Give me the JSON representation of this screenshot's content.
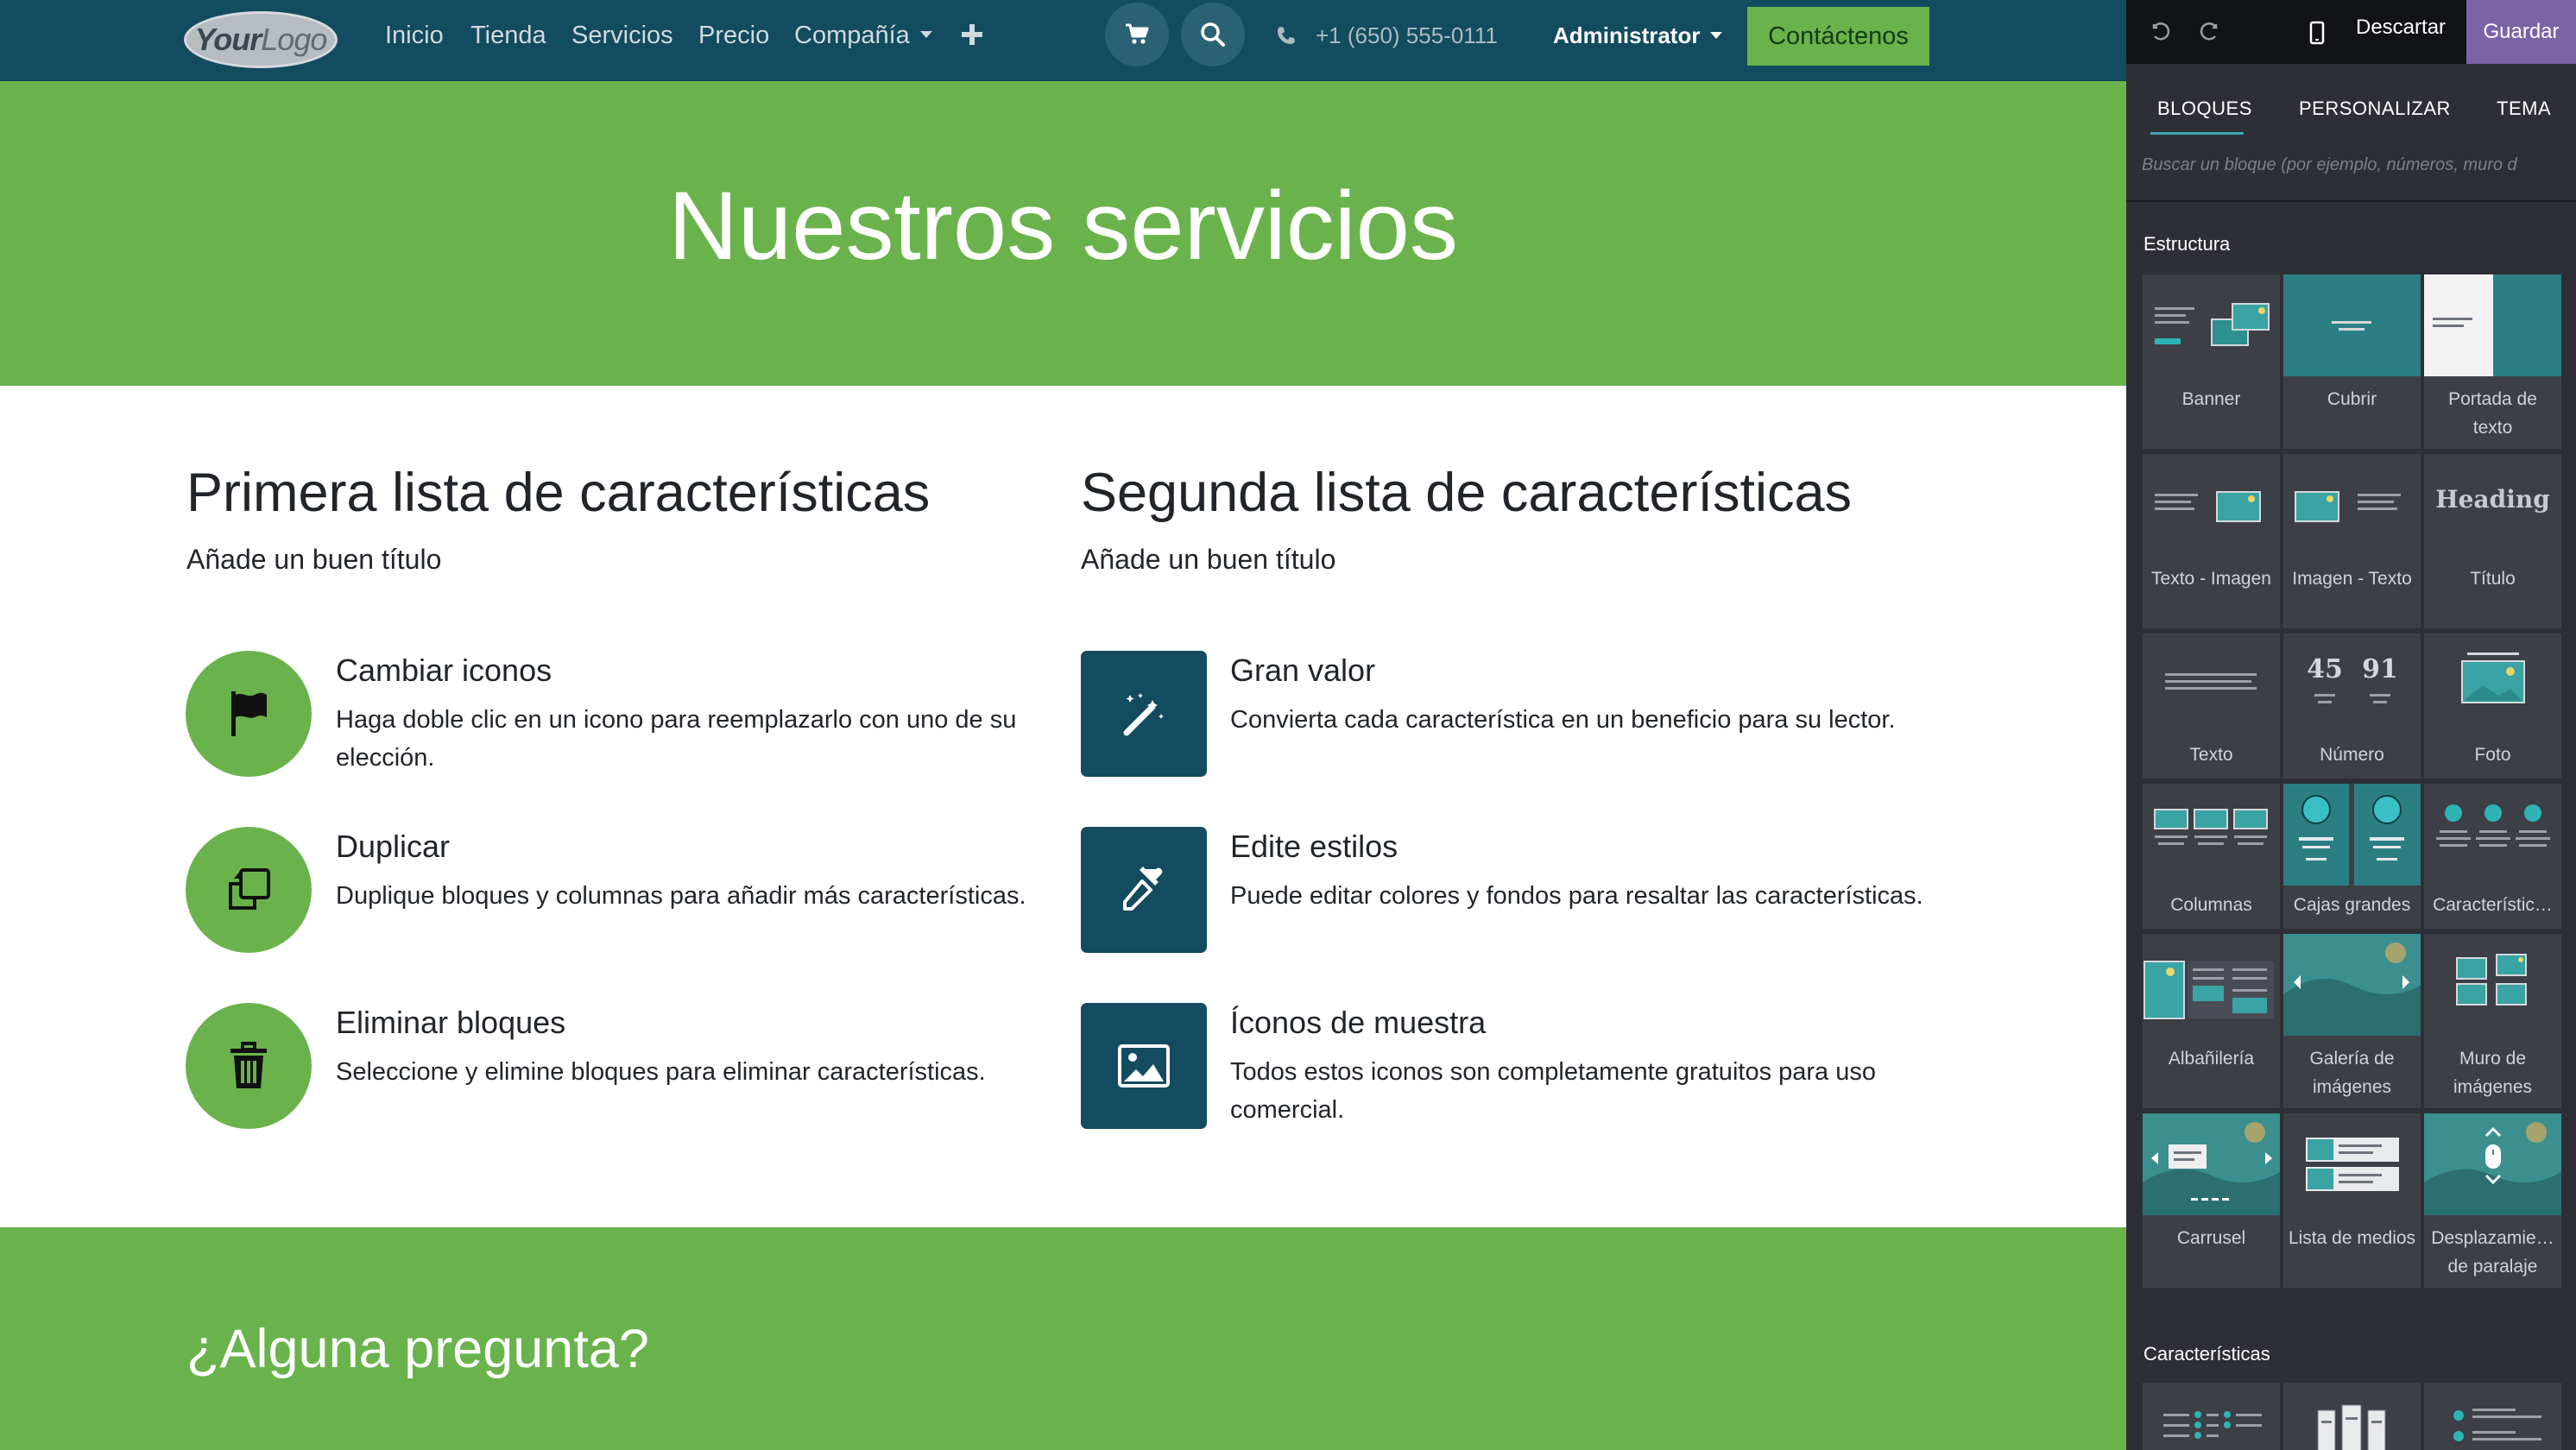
{
  "navbar": {
    "logo": {
      "part1": "Your",
      "part2": "Logo"
    },
    "items": [
      "Inicio",
      "Tienda",
      "Servicios",
      "Precio",
      "Compañía"
    ],
    "phone": "+1 (650) 555-0111",
    "user": "Administrator",
    "contact_label": "Contáctenos",
    "icons": [
      "plus-icon",
      "cart-icon",
      "search-icon",
      "phone-icon",
      "caret-down-icon"
    ]
  },
  "hero": {
    "title": "Nuestros servicios"
  },
  "features": {
    "list1": {
      "title": "Primera lista de características",
      "subtitle": "Añade un buen título",
      "items": [
        {
          "title": "Cambiar iconos",
          "text": "Haga doble clic en un icono para reemplazarlo con uno de su elección.",
          "icon": "flag-icon"
        },
        {
          "title": "Duplicar",
          "text": "Duplique bloques y columnas para añadir más características.",
          "icon": "copy-icon"
        },
        {
          "title": "Eliminar bloques",
          "text": "Seleccione y elimine bloques para eliminar características.",
          "icon": "trash-icon"
        }
      ]
    },
    "list2": {
      "title": "Segunda lista de características",
      "subtitle": "Añade un buen título",
      "items": [
        {
          "title": "Gran valor",
          "text": "Convierta cada característica en un beneficio para su lector.",
          "icon": "magic-wand-icon"
        },
        {
          "title": "Edite estilos",
          "text": "Puede editar colores y fondos para resaltar las características.",
          "icon": "eyedropper-icon"
        },
        {
          "title": "Íconos de muestra",
          "text": "Todos estos iconos son completamente gratuitos para uso comercial.",
          "icon": "image-icon"
        }
      ]
    }
  },
  "cta": {
    "title": "¿Alguna pregunta?"
  },
  "editor": {
    "discard_label": "Descartar",
    "save_label": "Guardar",
    "tabs": [
      "BLOQUES",
      "PERSONALIZAR",
      "TEMA"
    ],
    "active_tab": "BLOQUES",
    "search_placeholder": "Buscar un bloque (por ejemplo, números, muro d",
    "sections": [
      {
        "label": "Estructura",
        "blocks": [
          "Banner",
          "Cubrir",
          "Portada de texto",
          "Texto - Imagen",
          "Imagen - Texto",
          "Título",
          "Texto",
          "Número",
          "Foto",
          "Columnas",
          "Cajas grandes",
          "Característic…",
          "Albañilería",
          "Galería de imágenes",
          "Muro de imágenes",
          "Carrusel",
          "Lista de medios",
          "Desplazamie… de paralaje"
        ]
      },
      {
        "label": "Características"
      }
    ],
    "thumb_text": {
      "heading": "Heading",
      "n1": "45",
      "n2": "91"
    }
  },
  "colors": {
    "navbar": "#134b5f",
    "brand_green": "#6ab34c",
    "icon_dark": "#134b5f",
    "editor_bg": "#2e2f36",
    "save_purple": "#7a64a6",
    "tab_accent": "#3fa7b3"
  }
}
